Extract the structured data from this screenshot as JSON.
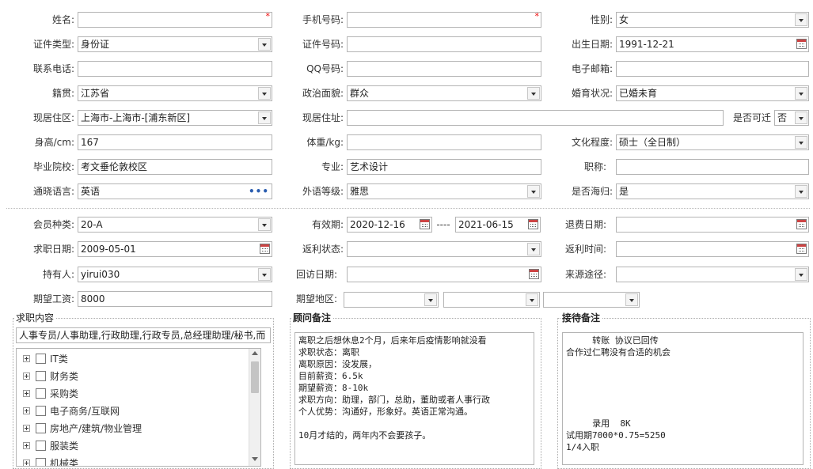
{
  "form": {
    "name_label": "姓名:",
    "name_value": "",
    "mobile_label": "手机号码:",
    "mobile_value": "",
    "gender_label": "性别:",
    "gender_value": "女",
    "id_type_label": "证件类型:",
    "id_type_value": "身份证",
    "id_number_label": "证件号码:",
    "id_number_value": "",
    "birth_label": "出生日期:",
    "birth_value": "1991-12-21",
    "phone_label": "联系电话:",
    "phone_value": "",
    "qq_label": "QQ号码:",
    "qq_value": "",
    "email_label": "电子邮箱:",
    "email_value": "",
    "native_label": "籍贯:",
    "native_value": "江苏省",
    "political_label": "政治面貌:",
    "political_value": "群众",
    "marital_label": "婚育状况:",
    "marital_value": "已婚未育",
    "residence_area_label": "现居住区:",
    "residence_area_value": "上海市-上海市-[浦东新区]",
    "residence_addr_label": "现居住址:",
    "residence_addr_value": "",
    "relocate_label": "是否可迁",
    "relocate_value": "否",
    "height_label": "身高/cm:",
    "height_value": "167",
    "weight_label": "体重/kg:",
    "weight_value": "",
    "education_label": "文化程度:",
    "education_value": "硕士（全日制）",
    "school_label": "毕业院校:",
    "school_value": "考文垂伦敦校区",
    "major_label": "专业:",
    "major_value": "艺术设计",
    "title_label": "职称:",
    "title_value": "",
    "language_label": "通晓语言:",
    "language_value": "英语",
    "lang_level_label": "外语等级:",
    "lang_level_value": "雅思",
    "overseas_label": "是否海归:",
    "overseas_value": "是"
  },
  "member": {
    "type_label": "会员种类:",
    "type_value": "20-A",
    "valid_label": "有效期:",
    "valid_from": "2020-12-16",
    "valid_sep": "----",
    "valid_to": "2021-06-15",
    "refund_date_label": "退费日期:",
    "refund_date_value": "",
    "job_date_label": "求职日期:",
    "job_date_value": "2009-05-01",
    "rebate_status_label": "返利状态:",
    "rebate_status_value": "",
    "rebate_time_label": "返利时间:",
    "rebate_time_value": "",
    "holder_label": "持有人:",
    "holder_value": "yirui030",
    "revisit_label": "回访日期:",
    "revisit_value": "",
    "source_label": "来源途径:",
    "source_value": "",
    "salary_label": "期望工资:",
    "salary_value": "8000",
    "region_label": "期望地区:",
    "region_values": [
      "",
      "",
      ""
    ]
  },
  "job_content": {
    "title": "求职内容",
    "summary": "人事专员/人事助理,行政助理,行政专员,总经理助理/秘书,而",
    "items": [
      "IT类",
      "财务类",
      "采购类",
      "电子商务/互联网",
      "房地产/建筑/物业管理",
      "服装类",
      "机械类"
    ]
  },
  "consultant_notes": {
    "title": "顾问备注",
    "text": "离职之后想休息2个月，后来年后疫情影响就没看\n求职状态：离职\n离职原因：没发展，\n目前薪资：6.5k\n期望薪资：8-10k\n求职方向：助理，部门，总助，董助或者人事行政\n个人优势：沟通好，形象好。英语正常沟通。\n\n10月才结的，两年内不会要孩子。"
  },
  "reception_notes": {
    "title": "接待备注",
    "text": "     转账 协议已回传\n合作过仁聘没有合适的机会\n\n\n\n\n\n     录用  8K\n试用期7000*0.75=5250\n1/4入职"
  },
  "icons": {
    "dropdown": "chevron-down-icon",
    "calendar": "calendar-icon",
    "more": "ellipsis-icon",
    "expand": "plus-box-icon",
    "checkbox": "checkbox-icon",
    "required": "asterisk-icon"
  },
  "colors": {
    "required": "#e00000",
    "border": "#b4b4b4",
    "link": "#2a5db0"
  }
}
